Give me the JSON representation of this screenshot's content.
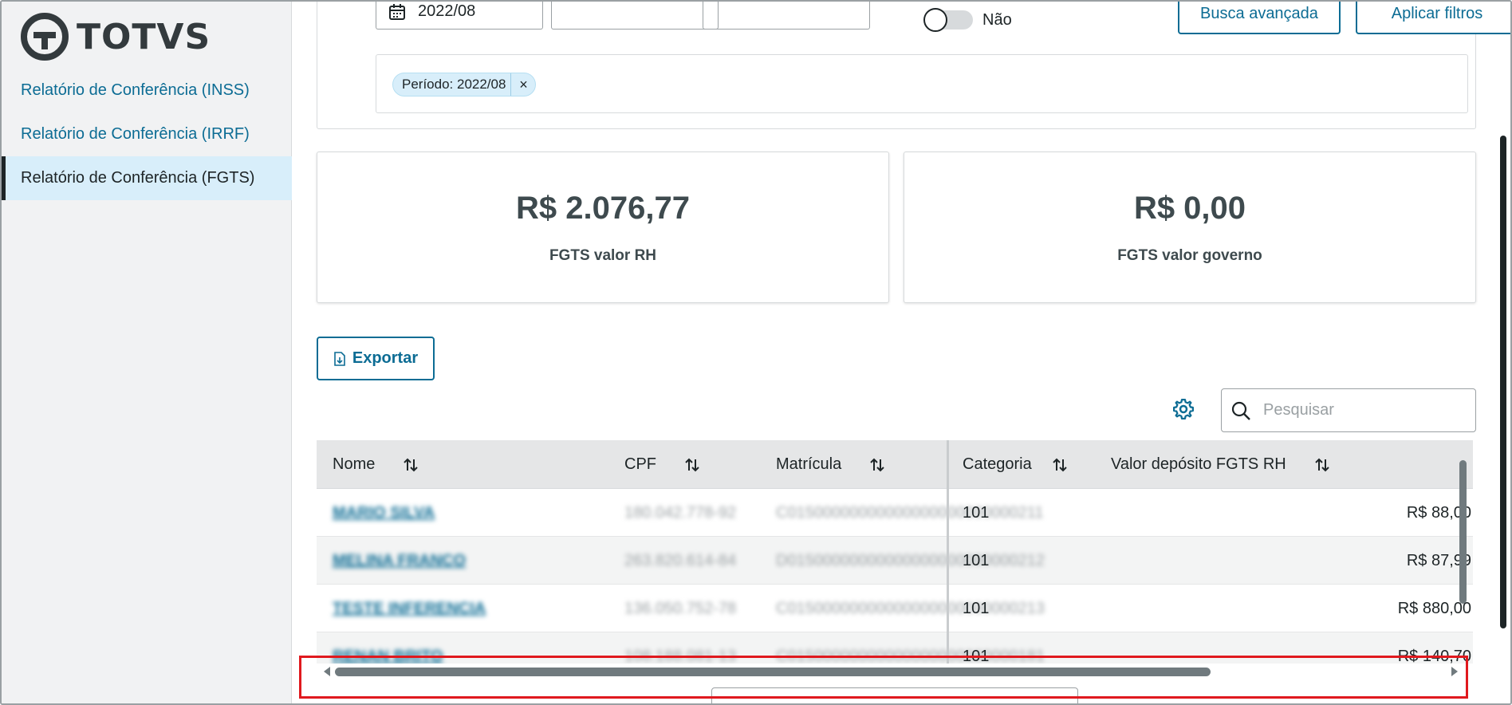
{
  "app": {
    "logo_text": "TOTVS"
  },
  "sidebar": {
    "items": [
      {
        "label": "Relatório de Conferência (INSS)",
        "active": false
      },
      {
        "label": "Relatório de Conferência (IRRF)",
        "active": false
      },
      {
        "label": "Relatório de Conferência (FGTS)",
        "active": true
      }
    ]
  },
  "filters": {
    "period_value": "2022/08",
    "toggle_label": "Não",
    "advanced_search_label": "Busca avançada",
    "apply_filters_label": "Aplicar filtros",
    "chips": [
      {
        "label": "Período: 2022/08"
      }
    ]
  },
  "stats": [
    {
      "value": "R$ 2.076,77",
      "label": "FGTS valor RH"
    },
    {
      "value": "R$ 0,00",
      "label": "FGTS valor governo"
    }
  ],
  "toolbar": {
    "export_label": "Exportar",
    "search_placeholder": "Pesquisar"
  },
  "table": {
    "columns": [
      "Nome",
      "CPF",
      "Matrícula",
      "Categoria",
      "Valor depósito FGTS RH"
    ],
    "rows": [
      {
        "nome": "MARIO SILVA",
        "cpf": "180.042.778-92",
        "matricula": "C01500000000000000000000000211",
        "categoria": "101",
        "valor": "R$ 88,00"
      },
      {
        "nome": "MELINA FRANCO",
        "cpf": "263.820.614-84",
        "matricula": "D01500000000000000000000000212",
        "categoria": "101",
        "valor": "R$ 87,99"
      },
      {
        "nome": "TESTE INFERENCIA",
        "cpf": "136.050.752-78",
        "matricula": "C01500000000000000000000000213",
        "categoria": "101",
        "valor": "R$ 880,00"
      },
      {
        "nome": "RENAN BRITO",
        "cpf": "108.188.081-13",
        "matricula": "C01500000000000000000000000181",
        "categoria": "101",
        "valor": "R$ 140,70"
      }
    ]
  },
  "colors": {
    "accent": "#0c6c94",
    "highlight": "#e0191e",
    "active_nav_bg": "#d8eefa"
  }
}
